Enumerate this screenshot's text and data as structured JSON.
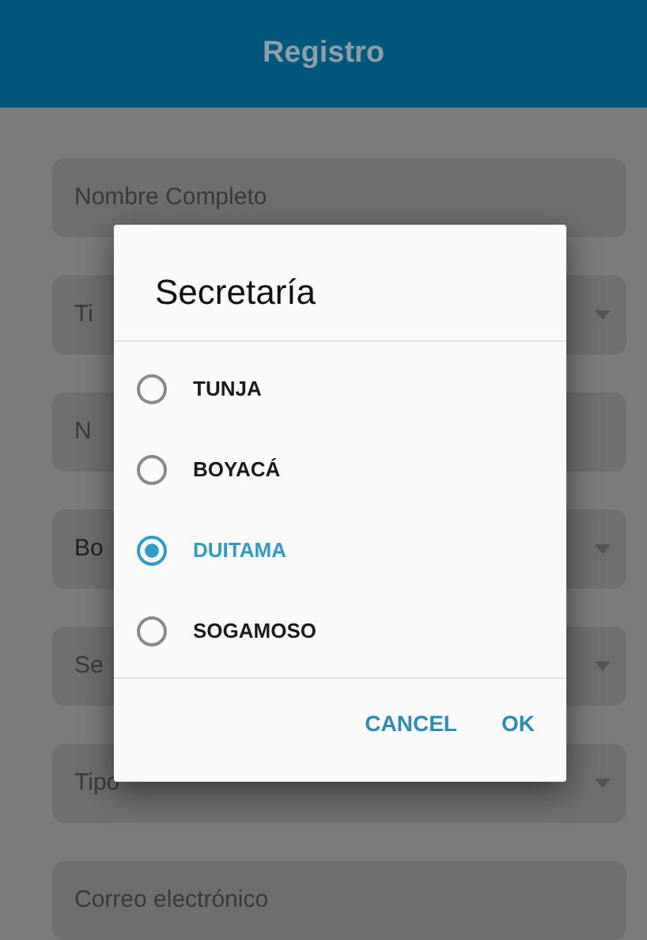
{
  "app_bar": {
    "title": "Registro"
  },
  "form_fields": [
    {
      "kind": "text",
      "placeholder": "Nombre Completo"
    },
    {
      "kind": "select",
      "placeholder": "Ti"
    },
    {
      "kind": "text",
      "placeholder": "N"
    },
    {
      "kind": "select",
      "value": "Bo"
    },
    {
      "kind": "select",
      "placeholder": "Se"
    },
    {
      "kind": "select",
      "placeholder": "Tipo"
    },
    {
      "kind": "text",
      "placeholder": "Correo electrónico"
    }
  ],
  "dialog": {
    "title": "Secretaría",
    "options": [
      {
        "label": "TUNJA",
        "selected": false
      },
      {
        "label": "BOYACÁ",
        "selected": false
      },
      {
        "label": "DUITAMA",
        "selected": true
      },
      {
        "label": "SOGAMOSO",
        "selected": false
      }
    ],
    "buttons": [
      "CANCEL",
      "OK"
    ]
  }
}
